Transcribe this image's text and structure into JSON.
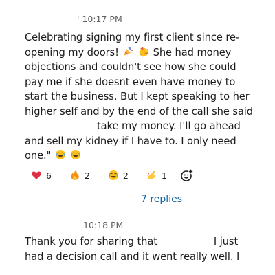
{
  "message1": {
    "time": "' 10:17 PM",
    "lines": [
      "Celebrating signing my first client since re-",
      "opening my doors!",
      "She had money",
      "objections and couldn't see how she could",
      "pay me if she doesnt even have money to",
      "start the business. But I kept speaking to her",
      "higher self and by the end of the call she said",
      "take my money. I'll go ahead",
      "and sell my kidney if I have to. I only need",
      "one.\""
    ]
  },
  "reactions": [
    {
      "icon": "heart-icon",
      "count": "6"
    },
    {
      "icon": "fire-icon",
      "count": "2"
    },
    {
      "icon": "laughing-icon",
      "count": "2"
    },
    {
      "icon": "pinched-fingers-icon",
      "count": "1"
    }
  ],
  "replies_link": "7 replies",
  "message2": {
    "time": "10:18 PM",
    "lines": [
      "Thank you for sharing that",
      "I just",
      "had a decision call and it went really well. I"
    ]
  },
  "colors": {
    "text": "#1d1c1d",
    "muted": "#616061",
    "link": "#1264a3"
  }
}
